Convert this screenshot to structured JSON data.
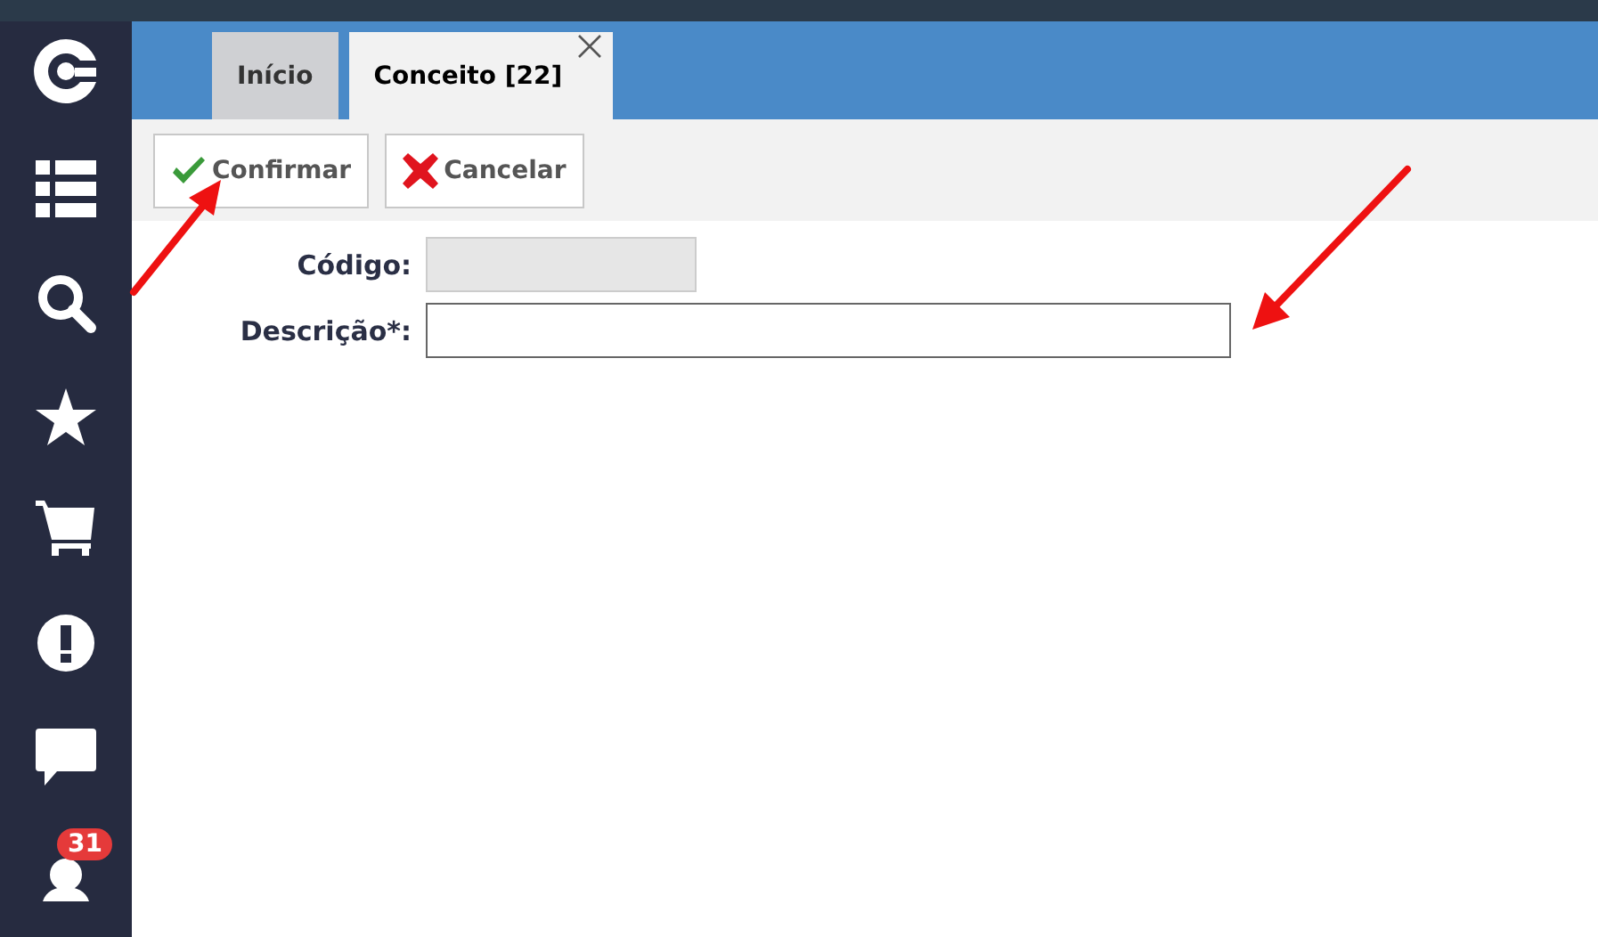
{
  "sidebar": {
    "items": [
      {
        "kind": "logo"
      },
      {
        "kind": "list"
      },
      {
        "kind": "search"
      },
      {
        "kind": "star"
      },
      {
        "kind": "cart"
      },
      {
        "kind": "alert"
      },
      {
        "kind": "chat"
      },
      {
        "kind": "user",
        "badge": "31"
      }
    ]
  },
  "tabs": [
    {
      "label": "Início",
      "selected": false,
      "closable": false
    },
    {
      "label": "Conceito [22]",
      "selected": true,
      "closable": true
    }
  ],
  "toolbar": [
    {
      "kind": "confirm",
      "label": "Confirmar"
    },
    {
      "kind": "cancel",
      "label": "Cancelar"
    }
  ],
  "form": [
    {
      "label": "Código:",
      "disabled": true
    },
    {
      "label": "Descrição*:",
      "disabled": false
    }
  ]
}
